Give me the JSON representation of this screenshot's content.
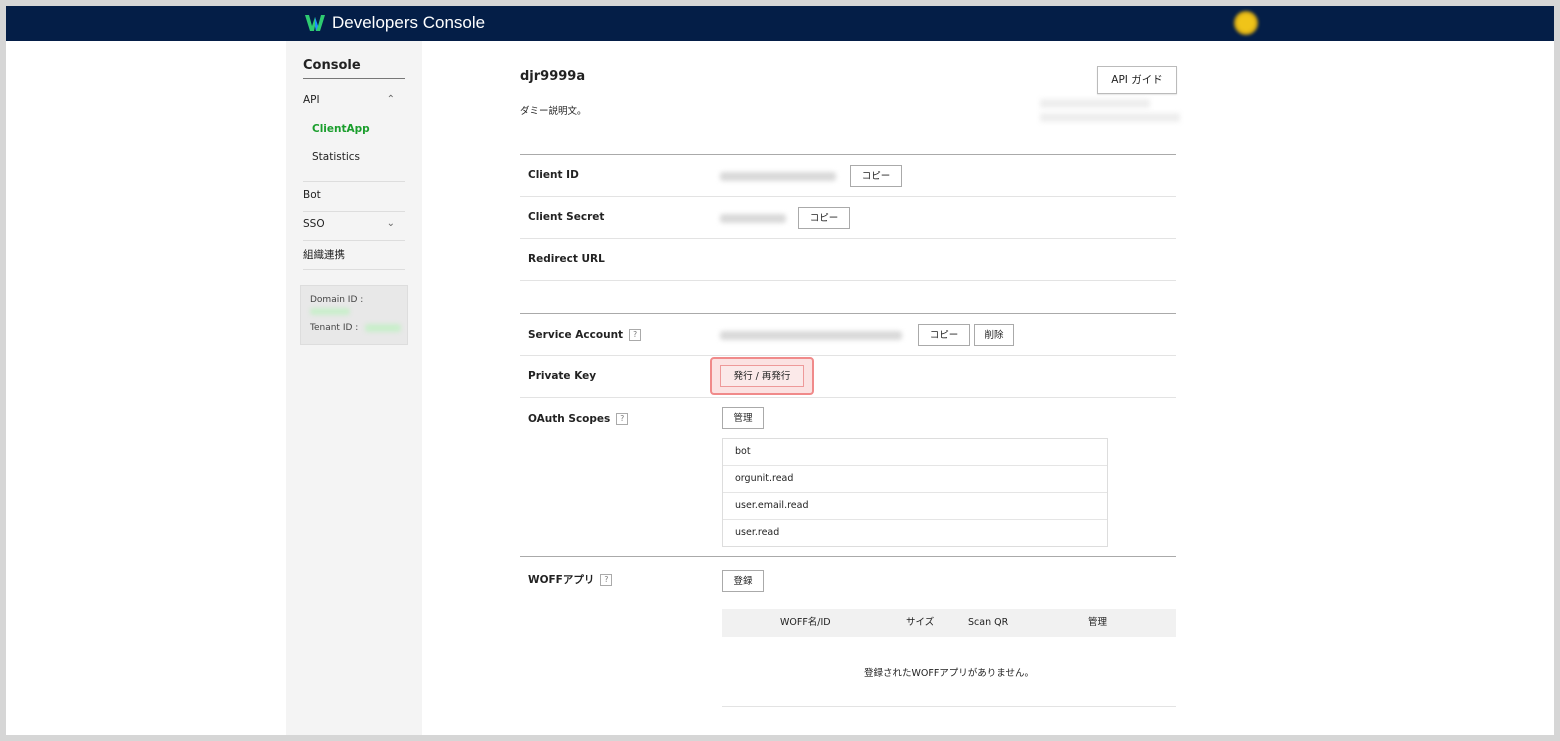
{
  "header": {
    "brand": "Developers Console",
    "logo_icon": "works-logo-icon",
    "accent": "#041e47"
  },
  "sidebar": {
    "title": "Console",
    "api_label": "API",
    "api_sub": [
      "ClientApp",
      "Statistics"
    ],
    "bot_label": "Bot",
    "sso_label": "SSO",
    "org_label": "組織連携",
    "domain_id_label": "Domain ID :",
    "tenant_id_label": "Tenant ID :",
    "active_color": "#1a9e2c"
  },
  "app": {
    "name": "djr9999a",
    "description": "ダミー説明文。",
    "api_guide_label": "API ガイド"
  },
  "fields": {
    "client_id_label": "Client ID",
    "client_secret_label": "Client Secret",
    "redirect_url_label": "Redirect URL",
    "service_account_label": "Service Account",
    "private_key_label": "Private Key",
    "oauth_scopes_label": "OAuth Scopes",
    "woff_label": "WOFFアプリ",
    "help_glyph": "?"
  },
  "buttons": {
    "copy": "コピー",
    "delete": "削除",
    "issue": "発行 / 再発行",
    "manage": "管理",
    "register": "登録"
  },
  "scopes": [
    "bot",
    "orgunit.read",
    "user.email.read",
    "user.read"
  ],
  "woff": {
    "columns": [
      "WOFF名/ID",
      "サイズ",
      "Scan QR",
      "管理"
    ],
    "empty_message": "登録されたWOFFアプリがありません。"
  }
}
